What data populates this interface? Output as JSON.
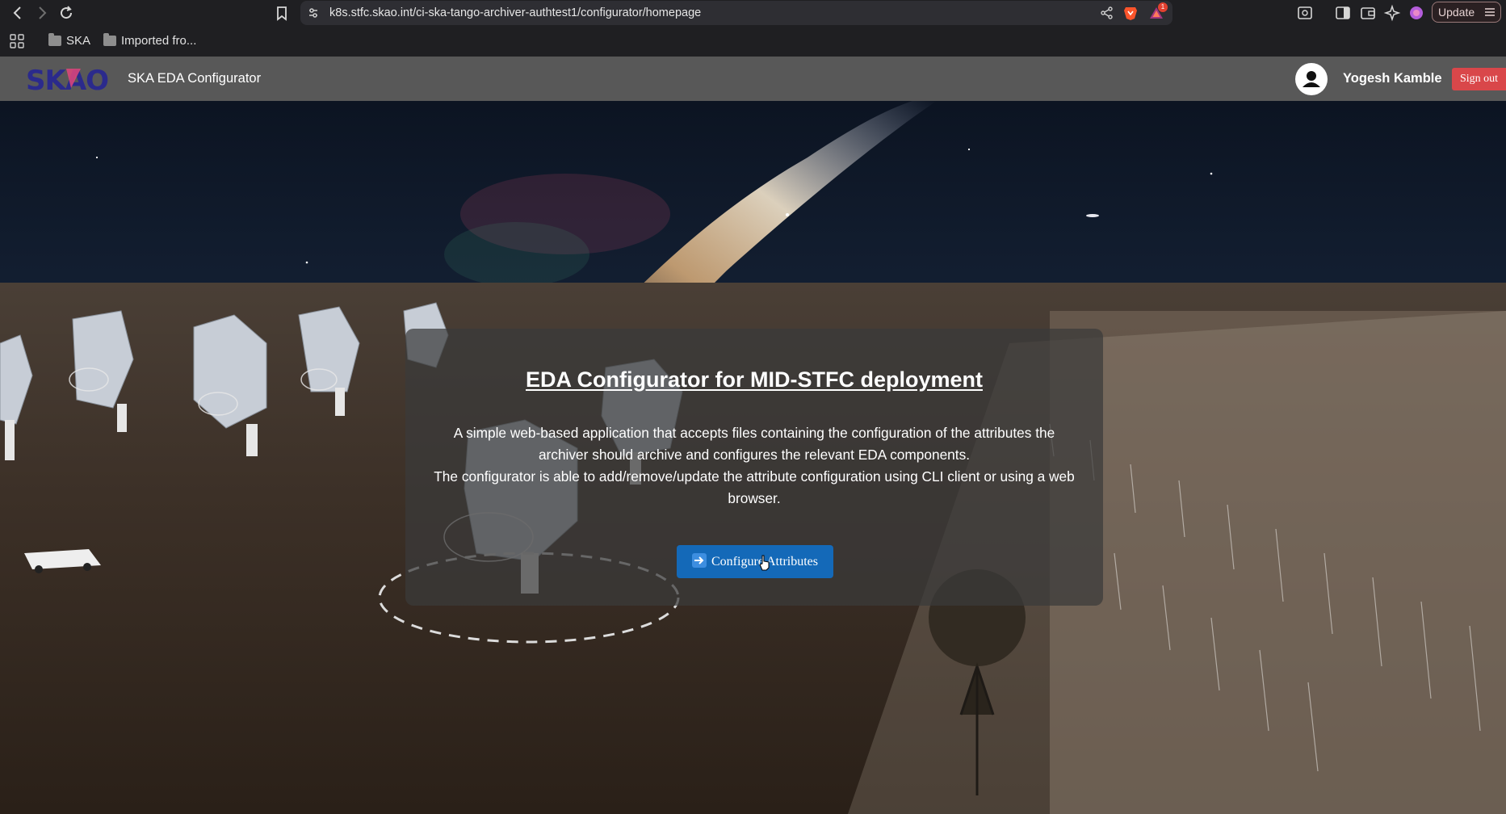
{
  "browser": {
    "url": "k8s.stfc.skao.int/ci-ska-tango-archiver-authtest1/configurator/homepage",
    "rewards_badge": "1",
    "update_label": "Update",
    "bookmarks": [
      {
        "label": "SKA",
        "icon": "folder-icon"
      },
      {
        "label": "Imported fro...",
        "icon": "folder-icon"
      }
    ]
  },
  "header": {
    "logo_text": "SKAO",
    "app_title": "SKA EDA Configurator",
    "user_name": "Yogesh Kamble",
    "signout_label": "Sign out"
  },
  "main": {
    "title": "EDA Configurator for MID-STFC deployment",
    "description_line1": "A simple web-based application that accepts files containing the configuration of the attributes the archiver should archive and configures the relevant EDA components.",
    "description_line2": "The configurator is able to add/remove/update the attribute configuration using CLI client or using a web browser.",
    "configure_button": "Configure Attributes"
  },
  "colors": {
    "header_bg": "#585858",
    "signout_bg": "#d9474a",
    "button_bg": "#1469b8",
    "logo_blue": "#2b2a8c",
    "logo_accent": "#e0457b"
  }
}
